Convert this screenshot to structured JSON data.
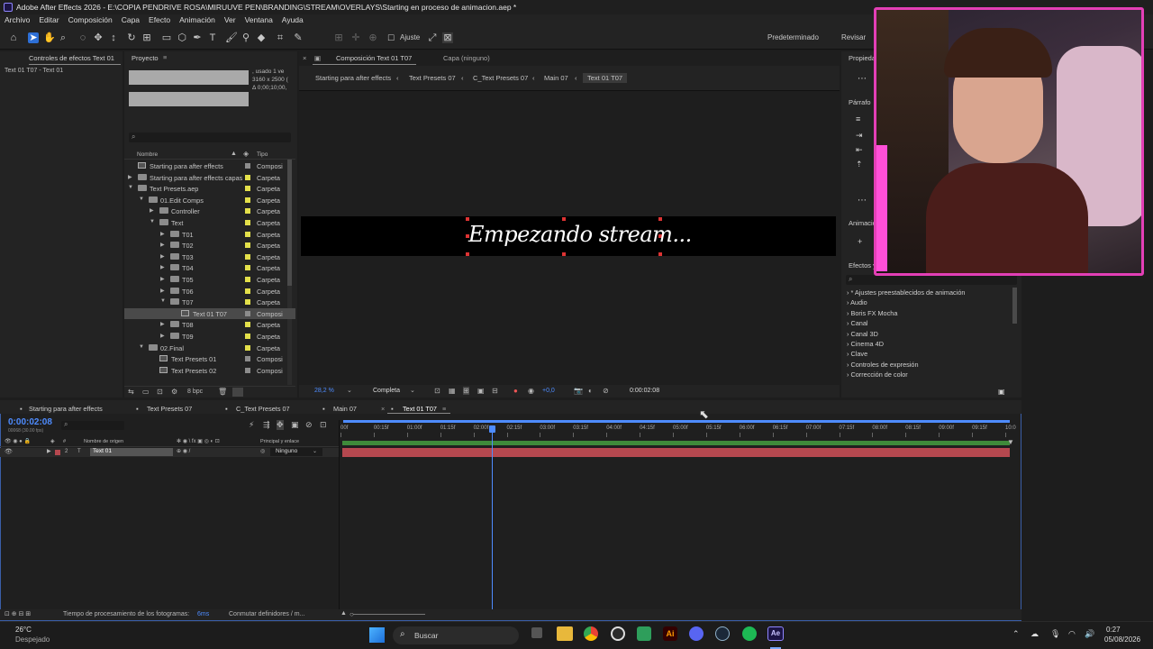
{
  "window": {
    "title": "Adobe After Effects 2026 - E:\\COPIA PENDRIVE ROSA\\MIRUUVE PEN\\BRANDING\\STREAM\\OVERLAYS\\Starting en proceso de animacion.aep *"
  },
  "menu": [
    "Archivo",
    "Editar",
    "Composición",
    "Capa",
    "Efecto",
    "Animación",
    "Ver",
    "Ventana",
    "Ayuda"
  ],
  "toolbar": {
    "snap_label": "Ajuste",
    "workspace_default": "Predeterminado",
    "workspace_review": "Revisar"
  },
  "effect_controls": {
    "tab": "Controles de efectos Text 01",
    "subtitle": "Text 01 T07 - Text 01"
  },
  "project": {
    "tab": "Proyecto",
    "info_used": ", usado 1 ve",
    "info_dims": "3160 x 2500 (",
    "info_dur": "Δ 0;00;10;00,",
    "search_placeholder": "",
    "col_name": "Nombre",
    "col_type": "Tipo",
    "bpc": "8 bpc",
    "rows": [
      {
        "name": "Starting para after effects",
        "type": "Composi",
        "kind": "comp",
        "indent": 0,
        "arrow": ""
      },
      {
        "name": "Starting para after effects capas",
        "type": "Carpeta",
        "kind": "folder",
        "indent": 0,
        "arrow": "▶"
      },
      {
        "name": "Text Presets.aep",
        "type": "Carpeta",
        "kind": "folder",
        "indent": 0,
        "arrow": "▼"
      },
      {
        "name": "01.Edit Comps",
        "type": "Carpeta",
        "kind": "folder",
        "indent": 1,
        "arrow": "▼"
      },
      {
        "name": "Controller",
        "type": "Carpeta",
        "kind": "folder",
        "indent": 2,
        "arrow": "▶"
      },
      {
        "name": "Text",
        "type": "Carpeta",
        "kind": "folder",
        "indent": 2,
        "arrow": "▼"
      },
      {
        "name": "T01",
        "type": "Carpeta",
        "kind": "folder",
        "indent": 3,
        "arrow": "▶"
      },
      {
        "name": "T02",
        "type": "Carpeta",
        "kind": "folder",
        "indent": 3,
        "arrow": "▶"
      },
      {
        "name": "T03",
        "type": "Carpeta",
        "kind": "folder",
        "indent": 3,
        "arrow": "▶"
      },
      {
        "name": "T04",
        "type": "Carpeta",
        "kind": "folder",
        "indent": 3,
        "arrow": "▶"
      },
      {
        "name": "T05",
        "type": "Carpeta",
        "kind": "folder",
        "indent": 3,
        "arrow": "▶"
      },
      {
        "name": "T06",
        "type": "Carpeta",
        "kind": "folder",
        "indent": 3,
        "arrow": "▶"
      },
      {
        "name": "T07",
        "type": "Carpeta",
        "kind": "folder",
        "indent": 3,
        "arrow": "▼"
      },
      {
        "name": "Text 01 T07",
        "type": "Composi",
        "kind": "comp",
        "indent": 4,
        "arrow": "",
        "selected": true
      },
      {
        "name": "T08",
        "type": "Carpeta",
        "kind": "folder",
        "indent": 3,
        "arrow": "▶"
      },
      {
        "name": "T09",
        "type": "Carpeta",
        "kind": "folder",
        "indent": 3,
        "arrow": "▶"
      },
      {
        "name": "02.Final",
        "type": "Carpeta",
        "kind": "folder",
        "indent": 1,
        "arrow": "▼"
      },
      {
        "name": "Text Presets 01",
        "type": "Composi",
        "kind": "comp",
        "indent": 2,
        "arrow": ""
      },
      {
        "name": "Text Presets 02",
        "type": "Composi",
        "kind": "comp",
        "indent": 2,
        "arrow": ""
      }
    ]
  },
  "composition": {
    "tab": "Composición Text 01 T07",
    "layer_tab": "Capa (ninguno)",
    "breadcrumbs": [
      "Starting para after effects",
      "Text Presets 07",
      "C_Text Presets 07",
      "Main 07",
      "Text 01 T07"
    ],
    "text": "Empezando stream...",
    "zoom": "28,2 %",
    "resolution": "Completa",
    "exposure": "+0,0",
    "timecode": "0:00:02:08"
  },
  "right_panel": {
    "props_tab": "Propieda",
    "para_tab": "Párrafo",
    "anim_tab": "Animacio",
    "effects_tab": "Efectos y",
    "search_placeholder": "",
    "effects": [
      "* Ajustes preestablecidos de animación",
      "Audio",
      "Boris FX Mocha",
      "Canal",
      "Canal 3D",
      "Cinema 4D",
      "Clave",
      "Controles de expresión",
      "Corrección de color"
    ]
  },
  "timeline": {
    "tabs": [
      "Starting para after effects",
      "Text Presets 07",
      "C_Text Presets 07",
      "Main 07",
      "Text 01 T07"
    ],
    "timecode": "0:00:02:08",
    "timecode_sub": "00068 (30.00 fps)",
    "col_source": "Nombre de origen",
    "col_parent": "Principal y enlace",
    "layer": {
      "number": "2",
      "type": "T",
      "name": "Text 01",
      "parent": "Ninguno"
    },
    "ruler": [
      "00f",
      "00:15f",
      "01:00f",
      "01:15f",
      "02:00f",
      "02:15f",
      "03:00f",
      "03:15f",
      "04:00f",
      "04:15f",
      "05:00f",
      "05:15f",
      "06:00f",
      "06:15f",
      "07:00f",
      "07:15f",
      "08:00f",
      "08:15f",
      "09:00f",
      "09:15f",
      "10:0"
    ],
    "status_text": "Tiempo de procesamiento de los fotogramas:",
    "status_value": "6ms",
    "toggle": "Conmutar definidores / m..."
  },
  "taskbar": {
    "temp": "26°C",
    "weather": "Despejado",
    "search": "Buscar",
    "time": "0:27",
    "date": "05/08/2026"
  },
  "colors": {
    "accent": "#2d6fd6",
    "timecode": "#4e8cff",
    "label_yellow": "#e3e04a",
    "layer_bar": "#b5484f",
    "webcam_border": "#e33fb6"
  }
}
